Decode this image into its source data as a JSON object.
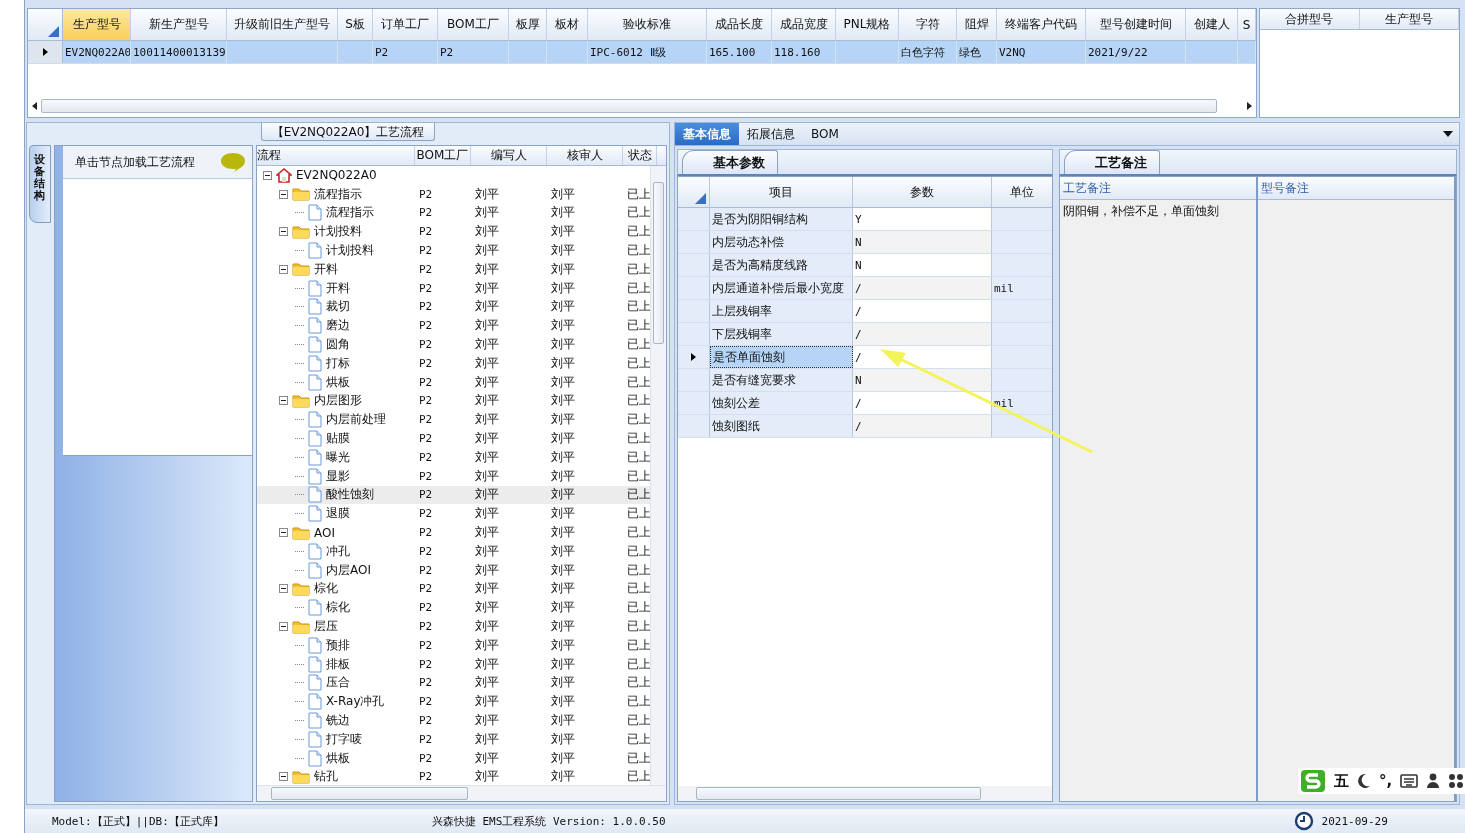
{
  "top_grid": {
    "columns": [
      {
        "label": "生产型号",
        "selected": true
      },
      {
        "label": "新生产型号",
        "selected": false
      },
      {
        "label": "升级前旧生产型号",
        "selected": false
      },
      {
        "label": "S板",
        "selected": false
      },
      {
        "label": "订单工厂",
        "selected": false
      },
      {
        "label": "BOM工厂",
        "selected": false
      },
      {
        "label": "板厚",
        "selected": false
      },
      {
        "label": "板材",
        "selected": false
      },
      {
        "label": "验收标准",
        "selected": false
      },
      {
        "label": "成品长度",
        "selected": false
      },
      {
        "label": "成品宽度",
        "selected": false
      },
      {
        "label": "PNL规格",
        "selected": false
      },
      {
        "label": "字符",
        "selected": false
      },
      {
        "label": "阻焊",
        "selected": false
      },
      {
        "label": "终端客户代码",
        "selected": false
      },
      {
        "label": "型号创建时间",
        "selected": false
      },
      {
        "label": "创建人",
        "selected": false
      },
      {
        "label": "S",
        "selected": false
      }
    ],
    "rows": [
      {
        "selected": true,
        "cells": [
          "EV2NQ022A0",
          "10011400013139",
          null,
          null,
          "P2",
          "P2",
          null,
          null,
          "IPC-6012 Ⅱ级",
          "165.100",
          "118.160",
          null,
          "白色字符",
          "绿色",
          "V2NQ",
          "2021/9/22",
          null,
          null
        ]
      }
    ]
  },
  "merge_panel": {
    "columns": [
      "合拼型号",
      "生产型号"
    ]
  },
  "process_panel": {
    "title": "【EV2NQ022A0】工艺流程",
    "side_tab": "设备结构",
    "hint": "单击节点加载工艺流程",
    "columns": [
      "流程",
      "BOM工厂",
      "编写人",
      "核审人",
      "状态"
    ],
    "tree": [
      {
        "label": "EV2NQ022A0",
        "kind": "root",
        "expanded": true,
        "selected": false,
        "children": [
          {
            "label": "流程指示",
            "kind": "folder",
            "expanded": true,
            "selected": false,
            "bom": "P2",
            "writer": "刘平",
            "reviewer": "刘平",
            "status": "已上",
            "children": [
              {
                "label": "流程指示",
                "kind": "file",
                "selected": false,
                "bom": "P2",
                "writer": "刘平",
                "reviewer": "刘平",
                "status": "已上"
              }
            ]
          },
          {
            "label": "计划投料",
            "kind": "folder",
            "expanded": true,
            "selected": false,
            "bom": "P2",
            "writer": "刘平",
            "reviewer": "刘平",
            "status": "已上",
            "children": [
              {
                "label": "计划投料",
                "kind": "file",
                "selected": false,
                "bom": "P2",
                "writer": "刘平",
                "reviewer": "刘平",
                "status": "已上"
              }
            ]
          },
          {
            "label": "开料",
            "kind": "folder",
            "expanded": true,
            "selected": false,
            "bom": "P2",
            "writer": "刘平",
            "reviewer": "刘平",
            "status": "已上",
            "children": [
              {
                "label": "开料",
                "kind": "file",
                "selected": false,
                "bom": "P2",
                "writer": "刘平",
                "reviewer": "刘平",
                "status": "已上"
              },
              {
                "label": "裁切",
                "kind": "file",
                "selected": false,
                "bom": "P2",
                "writer": "刘平",
                "reviewer": "刘平",
                "status": "已上"
              },
              {
                "label": "磨边",
                "kind": "file",
                "selected": false,
                "bom": "P2",
                "writer": "刘平",
                "reviewer": "刘平",
                "status": "已上"
              },
              {
                "label": "圆角",
                "kind": "file",
                "selected": false,
                "bom": "P2",
                "writer": "刘平",
                "reviewer": "刘平",
                "status": "已上"
              },
              {
                "label": "打标",
                "kind": "file",
                "selected": false,
                "bom": "P2",
                "writer": "刘平",
                "reviewer": "刘平",
                "status": "已上"
              },
              {
                "label": "烘板",
                "kind": "file",
                "selected": false,
                "bom": "P2",
                "writer": "刘平",
                "reviewer": "刘平",
                "status": "已上"
              }
            ]
          },
          {
            "label": "内层图形",
            "kind": "folder",
            "expanded": true,
            "selected": false,
            "bom": "P2",
            "writer": "刘平",
            "reviewer": "刘平",
            "status": "已上",
            "children": [
              {
                "label": "内层前处理",
                "kind": "file",
                "selected": false,
                "bom": "P2",
                "writer": "刘平",
                "reviewer": "刘平",
                "status": "已上"
              },
              {
                "label": "贴膜",
                "kind": "file",
                "selected": false,
                "bom": "P2",
                "writer": "刘平",
                "reviewer": "刘平",
                "status": "已上"
              },
              {
                "label": "曝光",
                "kind": "file",
                "selected": false,
                "bom": "P2",
                "writer": "刘平",
                "reviewer": "刘平",
                "status": "已上"
              },
              {
                "label": "显影",
                "kind": "file",
                "selected": false,
                "bom": "P2",
                "writer": "刘平",
                "reviewer": "刘平",
                "status": "已上"
              },
              {
                "label": "酸性蚀刻",
                "kind": "file",
                "selected": true,
                "bom": "P2",
                "writer": "刘平",
                "reviewer": "刘平",
                "status": "已上"
              },
              {
                "label": "退膜",
                "kind": "file",
                "selected": false,
                "bom": "P2",
                "writer": "刘平",
                "reviewer": "刘平",
                "status": "已上"
              }
            ]
          },
          {
            "label": "AOI",
            "kind": "folder",
            "expanded": true,
            "selected": false,
            "bom": "P2",
            "writer": "刘平",
            "reviewer": "刘平",
            "status": "已上",
            "children": [
              {
                "label": "冲孔",
                "kind": "file",
                "selected": false,
                "bom": "P2",
                "writer": "刘平",
                "reviewer": "刘平",
                "status": "已上"
              },
              {
                "label": "内层AOI",
                "kind": "file",
                "selected": false,
                "bom": "P2",
                "writer": "刘平",
                "reviewer": "刘平",
                "status": "已上"
              }
            ]
          },
          {
            "label": "棕化",
            "kind": "folder",
            "expanded": true,
            "selected": false,
            "bom": "P2",
            "writer": "刘平",
            "reviewer": "刘平",
            "status": "已上",
            "children": [
              {
                "label": "棕化",
                "kind": "file",
                "selected": false,
                "bom": "P2",
                "writer": "刘平",
                "reviewer": "刘平",
                "status": "已上"
              }
            ]
          },
          {
            "label": "层压",
            "kind": "folder",
            "expanded": true,
            "selected": false,
            "bom": "P2",
            "writer": "刘平",
            "reviewer": "刘平",
            "status": "已上",
            "children": [
              {
                "label": "预排",
                "kind": "file",
                "selected": false,
                "bom": "P2",
                "writer": "刘平",
                "reviewer": "刘平",
                "status": "已上"
              },
              {
                "label": "排板",
                "kind": "file",
                "selected": false,
                "bom": "P2",
                "writer": "刘平",
                "reviewer": "刘平",
                "status": "已上"
              },
              {
                "label": "压合",
                "kind": "file",
                "selected": false,
                "bom": "P2",
                "writer": "刘平",
                "reviewer": "刘平",
                "status": "已上"
              },
              {
                "label": "X-Ray冲孔",
                "kind": "file",
                "selected": false,
                "bom": "P2",
                "writer": "刘平",
                "reviewer": "刘平",
                "status": "已上"
              },
              {
                "label": "铣边",
                "kind": "file",
                "selected": false,
                "bom": "P2",
                "writer": "刘平",
                "reviewer": "刘平",
                "status": "已上"
              },
              {
                "label": "打字唛",
                "kind": "file",
                "selected": false,
                "bom": "P2",
                "writer": "刘平",
                "reviewer": "刘平",
                "status": "已上"
              },
              {
                "label": "烘板",
                "kind": "file",
                "selected": false,
                "bom": "P2",
                "writer": "刘平",
                "reviewer": "刘平",
                "status": "已上"
              }
            ]
          },
          {
            "label": "钻孔",
            "kind": "folder",
            "expanded": true,
            "selected": false,
            "bom": "P2",
            "writer": "刘平",
            "reviewer": "刘平",
            "status": "已上"
          }
        ]
      }
    ]
  },
  "detail_tabs": [
    {
      "label": "基本信息",
      "selected": true
    },
    {
      "label": "拓展信息",
      "selected": false
    },
    {
      "label": "BOM",
      "selected": false
    }
  ],
  "params": {
    "tab": "基本参数",
    "columns": [
      "项目",
      "参数",
      "单位"
    ],
    "rows": [
      {
        "item": "是否为阴阳铜结构",
        "value": "Y",
        "selected": false
      },
      {
        "item": "内层动态补偿",
        "value": "N",
        "selected": false
      },
      {
        "item": "是否为高精度线路",
        "value": "N",
        "selected": false
      },
      {
        "item": "内层通道补偿后最小宽度",
        "value": "/",
        "unit": "mil",
        "selected": false
      },
      {
        "item": "上层残铜率",
        "value": "/",
        "selected": false
      },
      {
        "item": "下层残铜率",
        "value": "/",
        "selected": false
      },
      {
        "item": "是否单面蚀刻",
        "value": "/",
        "selected": true
      },
      {
        "item": "是否有缝宽要求",
        "value": "N",
        "selected": false
      },
      {
        "item": "蚀刻公差",
        "value": "/",
        "unit": "mil",
        "selected": false
      },
      {
        "item": "蚀刻图纸",
        "value": "/",
        "selected": false
      }
    ]
  },
  "notes": {
    "tab": "工艺备注",
    "columns": [
      "工艺备注",
      "型号备注"
    ],
    "process_note": "阴阳铜，补偿不足，单面蚀刻"
  },
  "ime_toolbar": {
    "mode": "五",
    "punctuation": "°,"
  },
  "status_bar": {
    "model": "Model:【正式】||DB:【正式库】",
    "product": "兴森快捷 EMS工程系统 Version: 1.0.0.50",
    "datetime": "2021-09-29"
  }
}
